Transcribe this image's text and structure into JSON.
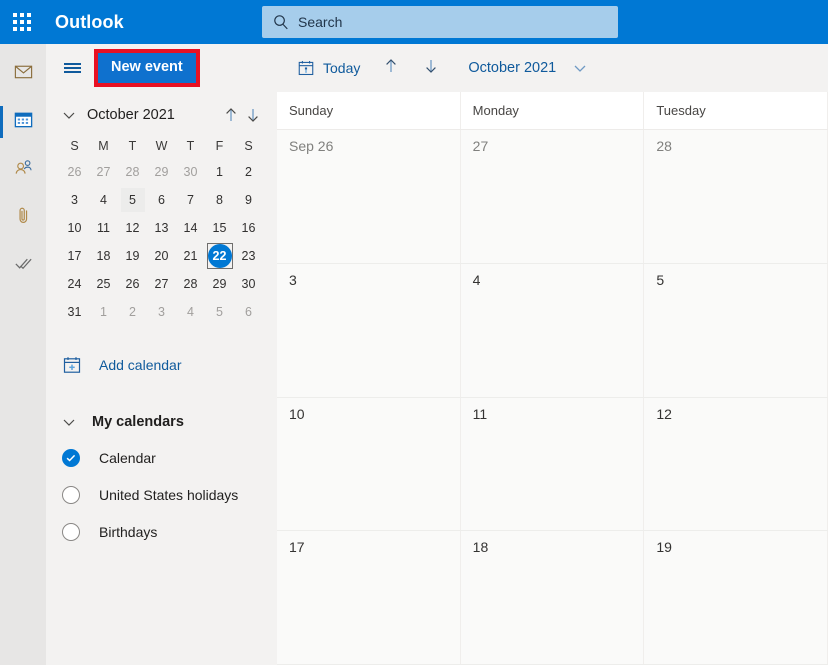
{
  "app": {
    "brand": "Outlook",
    "waffle_icon": "app-launcher-icon"
  },
  "search": {
    "placeholder": "Search",
    "value": "Search",
    "icon": "search-icon"
  },
  "rail": {
    "items": [
      {
        "icon": "mail-icon",
        "name": "mail",
        "selected": false
      },
      {
        "icon": "calendar-icon",
        "name": "calendar",
        "selected": true
      },
      {
        "icon": "people-icon",
        "name": "people",
        "selected": false
      },
      {
        "icon": "attachment-icon",
        "name": "files",
        "selected": false
      },
      {
        "icon": "checkmark-icon",
        "name": "to-do",
        "selected": false
      }
    ]
  },
  "sidebar": {
    "hamburger_icon": "hamburger-icon",
    "new_event_label": "New event",
    "new_event_highlight_color": "#e81123",
    "mini_calendar": {
      "collapse_icon": "chevron-down-icon",
      "title": "October 2021",
      "prev_icon": "arrow-up-icon",
      "next_icon": "arrow-down-icon",
      "day_headers": [
        "S",
        "M",
        "T",
        "W",
        "T",
        "F",
        "S"
      ],
      "weeks": [
        [
          {
            "n": "26",
            "muted": true
          },
          {
            "n": "27",
            "muted": true
          },
          {
            "n": "28",
            "muted": true
          },
          {
            "n": "29",
            "muted": true
          },
          {
            "n": "30",
            "muted": true
          },
          {
            "n": "1",
            "muted": false
          },
          {
            "n": "2",
            "muted": false
          }
        ],
        [
          {
            "n": "3",
            "muted": false
          },
          {
            "n": "4",
            "muted": false
          },
          {
            "n": "5",
            "muted": false,
            "hover": true
          },
          {
            "n": "6",
            "muted": false
          },
          {
            "n": "7",
            "muted": false
          },
          {
            "n": "8",
            "muted": false
          },
          {
            "n": "9",
            "muted": false
          }
        ],
        [
          {
            "n": "10",
            "muted": false
          },
          {
            "n": "11",
            "muted": false
          },
          {
            "n": "12",
            "muted": false
          },
          {
            "n": "13",
            "muted": false
          },
          {
            "n": "14",
            "muted": false
          },
          {
            "n": "15",
            "muted": false
          },
          {
            "n": "16",
            "muted": false
          }
        ],
        [
          {
            "n": "17",
            "muted": false
          },
          {
            "n": "18",
            "muted": false
          },
          {
            "n": "19",
            "muted": false
          },
          {
            "n": "20",
            "muted": false
          },
          {
            "n": "21",
            "muted": false
          },
          {
            "n": "22",
            "muted": false,
            "today": true,
            "focused": true
          },
          {
            "n": "23",
            "muted": false
          }
        ],
        [
          {
            "n": "24",
            "muted": false
          },
          {
            "n": "25",
            "muted": false
          },
          {
            "n": "26",
            "muted": false
          },
          {
            "n": "27",
            "muted": false
          },
          {
            "n": "28",
            "muted": false
          },
          {
            "n": "29",
            "muted": false
          },
          {
            "n": "30",
            "muted": false
          }
        ],
        [
          {
            "n": "31",
            "muted": false
          },
          {
            "n": "1",
            "muted": true
          },
          {
            "n": "2",
            "muted": true
          },
          {
            "n": "3",
            "muted": true
          },
          {
            "n": "4",
            "muted": true
          },
          {
            "n": "5",
            "muted": true
          },
          {
            "n": "6",
            "muted": true
          }
        ]
      ]
    },
    "add_calendar": {
      "label": "Add calendar",
      "icon": "calendar-add-icon"
    },
    "my_calendars": {
      "label": "My calendars",
      "collapse_icon": "chevron-down-icon",
      "items": [
        {
          "label": "Calendar",
          "checked": true
        },
        {
          "label": "United States holidays",
          "checked": false
        },
        {
          "label": "Birthdays",
          "checked": false
        }
      ]
    }
  },
  "calendar": {
    "toolbar": {
      "today_label": "Today",
      "today_icon": "calendar-today-icon",
      "prev_icon": "arrow-up-icon",
      "next_icon": "arrow-down-icon",
      "month_label": "October 2021",
      "view_chevron_icon": "chevron-down-icon"
    },
    "day_headers": [
      "Sunday",
      "Monday",
      "Tuesday"
    ],
    "weeks": [
      [
        {
          "label": "Sep 26",
          "other_month": true
        },
        {
          "label": "27",
          "other_month": true
        },
        {
          "label": "28",
          "other_month": true
        }
      ],
      [
        {
          "label": "3",
          "other_month": false
        },
        {
          "label": "4",
          "other_month": false
        },
        {
          "label": "5",
          "other_month": false
        }
      ],
      [
        {
          "label": "10",
          "other_month": false
        },
        {
          "label": "11",
          "other_month": false
        },
        {
          "label": "12",
          "other_month": false
        }
      ],
      [
        {
          "label": "17",
          "other_month": false
        },
        {
          "label": "18",
          "other_month": false
        },
        {
          "label": "19",
          "other_month": false
        }
      ]
    ]
  },
  "colors": {
    "brand_blue": "#0078d4",
    "link_blue": "#0f5a9c",
    "highlight_red": "#e81123",
    "sidebar_bg": "#f3f2f1",
    "rail_bg": "#e7e6e5"
  }
}
